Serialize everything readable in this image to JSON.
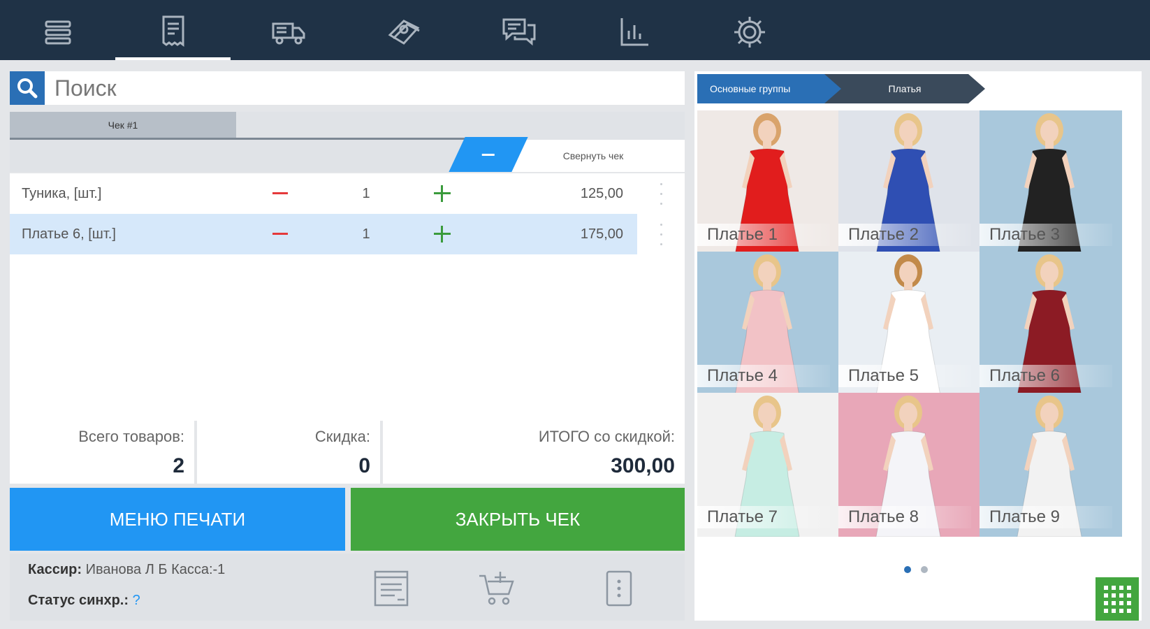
{
  "topbar": {
    "icons": [
      "menu-icon",
      "receipt-icon",
      "delivery-truck-icon",
      "money-icon",
      "chat-icon",
      "bar-chart-icon",
      "settings-gear-icon"
    ],
    "active_index": 1
  },
  "search": {
    "placeholder": "Поиск"
  },
  "receipt_tab": {
    "label": "Чек #1"
  },
  "collapse": {
    "label": "Свернуть чек"
  },
  "items": [
    {
      "name": "Туника, [шт.]",
      "qty": "1",
      "price": "125,00",
      "selected": false
    },
    {
      "name": "Платье 6, [шт.]",
      "qty": "1",
      "price": "175,00",
      "selected": true
    }
  ],
  "totals": {
    "items_label": "Всего товаров:",
    "items_value": "2",
    "discount_label": "Скидка:",
    "discount_value": "0",
    "total_label": "ИТОГО со скидкой:",
    "total_value": "300,00"
  },
  "buttons": {
    "print_menu": "МЕНЮ ПЕЧАТИ",
    "close_receipt": "ЗАКРЫТЬ ЧЕК"
  },
  "footer": {
    "cashier_label": "Кассир:",
    "cashier_value": "Иванова Л Б Касса:-1",
    "sync_label": "Статус синхр.:",
    "sync_value": "?"
  },
  "breadcrumb": {
    "root": "Основные группы",
    "current": "Платья"
  },
  "products": [
    {
      "label": "Платье 1",
      "bg": "#efe9e6",
      "dress": "#e11d1d",
      "hair": "#d9a36b"
    },
    {
      "label": "Платье 2",
      "bg": "#dfe3ea",
      "dress": "#2f4fb3",
      "hair": "#e8c58a"
    },
    {
      "label": "Платье 3",
      "bg": "#a9c8dc",
      "dress": "#222222",
      "hair": "#e8c58a"
    },
    {
      "label": "Платье 4",
      "bg": "#a9c8dc",
      "dress": "#f2c2c6",
      "hair": "#e8c58a"
    },
    {
      "label": "Платье 5",
      "bg": "#e9eef3",
      "dress": "#ffffff",
      "hair": "#c28a4a"
    },
    {
      "label": "Платье 6",
      "bg": "#a9c8dc",
      "dress": "#8c1b24",
      "hair": "#e8c58a"
    },
    {
      "label": "Платье 7",
      "bg": "#f1f1f1",
      "dress": "#c6ede3",
      "hair": "#e8c58a"
    },
    {
      "label": "Платье 8",
      "bg": "#e8a7b8",
      "dress": "#f4f4f8",
      "hair": "#e8c58a"
    },
    {
      "label": "Платье 9",
      "bg": "#a9c8dc",
      "dress": "#f2f2f2",
      "hair": "#e8c58a"
    }
  ],
  "pagination": {
    "pages": 2,
    "current": 1
  },
  "colors": {
    "topbar": "#1f3246",
    "blue": "#2196f3",
    "green": "#43a63f",
    "minus_red": "#e5393b",
    "plus_green": "#3a9b3c"
  }
}
